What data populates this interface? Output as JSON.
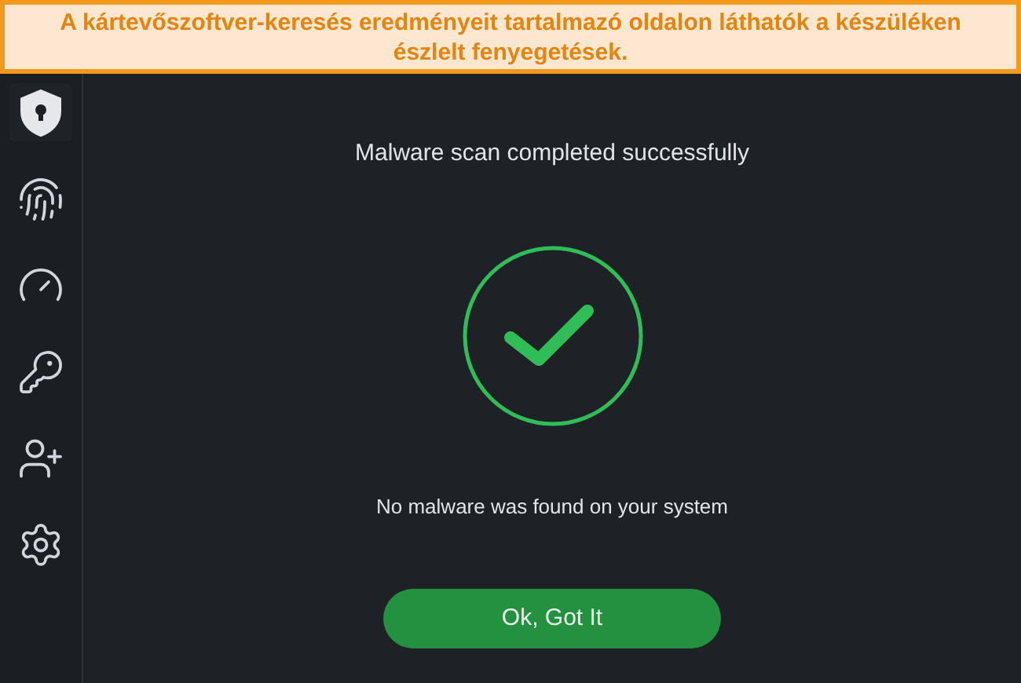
{
  "caption": "A kártevőszoftver-keresés eredményeit tartalmazó oldalon láthatók a készüléken észlelt fenyegetések.",
  "sidebar": {
    "items": [
      {
        "kind": "shield",
        "selected": true
      },
      {
        "kind": "fingerprint",
        "selected": false
      },
      {
        "kind": "speed",
        "selected": false
      },
      {
        "kind": "key",
        "selected": false
      },
      {
        "kind": "add-user",
        "selected": false
      },
      {
        "kind": "settings",
        "selected": false
      }
    ]
  },
  "result": {
    "title": "Malware scan completed successfully",
    "kind": "success",
    "message": "No malware was found on your system",
    "button": "Ok, Got It"
  }
}
